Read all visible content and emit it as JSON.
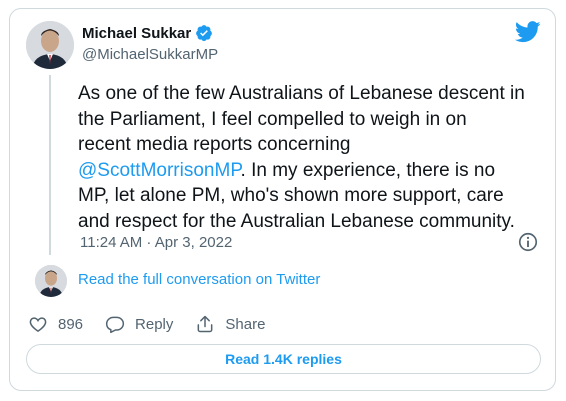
{
  "author": {
    "name": "Michael Sukkar",
    "handle": "@MichaelSukkarMP",
    "verified_icon": "verified-badge-icon"
  },
  "tweet": {
    "text_before": "As one of the few Australians of Lebanese descent in\nthe Parliament, I feel compelled to weigh in on\nrecent media reports concerning\n",
    "mention": "@ScottMorrisonMP",
    "text_after": ". In my experience, there is no\nMP, let alone PM, who's shown more support, care\nand respect for the Australian Lebanese community.",
    "timestamp": "11:24 AM · Apr 3, 2022"
  },
  "conversation_link": "Read the full conversation on Twitter",
  "actions": {
    "like_count": "896",
    "reply_label": "Reply",
    "share_label": "Share"
  },
  "read_replies_label": "Read 1.4K replies",
  "colors": {
    "accent": "#1d9bf0",
    "text": "#0f1419",
    "muted": "#536471",
    "border": "#cfd9de"
  }
}
